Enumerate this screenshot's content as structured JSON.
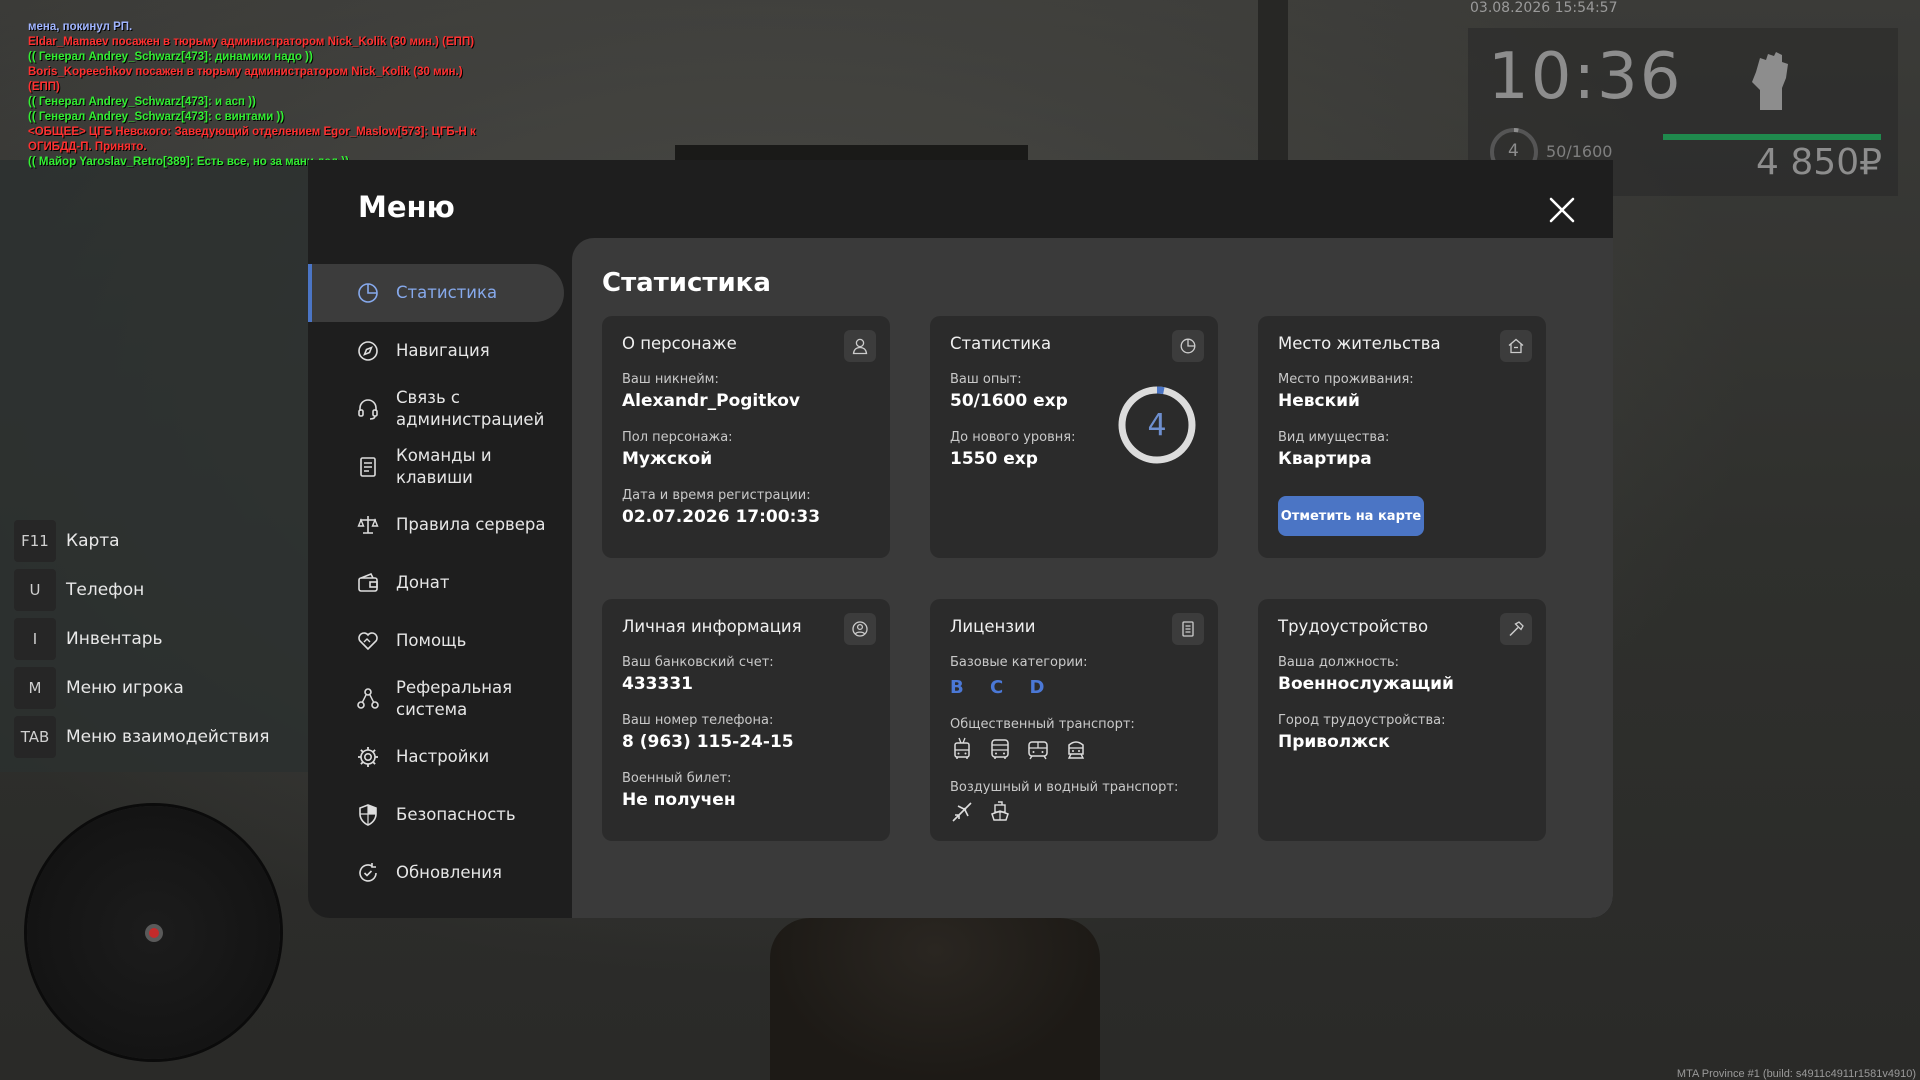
{
  "chat": [
    {
      "text": "мена, покинул РП.",
      "color": "blue"
    },
    {
      "text": "Eldar_Mamaev посажен в тюрьму администратором Nick_Kolik (30 мин.) (ЕПП)",
      "color": "red"
    },
    {
      "text": "(( Генерал Andrey_Schwarz[473]: динамики надо ))",
      "color": "green"
    },
    {
      "text": "Boris_Kopeechkov посажен в тюрьму администратором Nick_Kolik (30 мин.)",
      "color": "red"
    },
    {
      "text": "(ЕПП)",
      "color": "red"
    },
    {
      "text": "(( Генерал Andrey_Schwarz[473]: и асп ))",
      "color": "green"
    },
    {
      "text": "(( Генерал Andrey_Schwarz[473]: с винтами ))",
      "color": "green"
    },
    {
      "text": "<ОБЩЕЕ> ЦГБ Невского: Заведующий отделением Egor_Maslow[573]: ЦГБ-Н к",
      "color": "red"
    },
    {
      "text": " ОГИБДД-П. Принято.",
      "color": "red"
    },
    {
      "text": "(( Майор Yaroslav_Retro[389]: Есть все, но за мани дед ))",
      "color": "green"
    }
  ],
  "hud": {
    "datetime": "03.08.2026 15:54:57",
    "clock": "10:36",
    "level": "4",
    "exp": "50/1600",
    "money": "4 850₽",
    "fist_icon": "fist-icon"
  },
  "keys": [
    {
      "key": "F11",
      "label": "Карта"
    },
    {
      "key": "U",
      "label": "Телефон"
    },
    {
      "key": "I",
      "label": "Инвентарь"
    },
    {
      "key": "M",
      "label": "Меню игрока"
    },
    {
      "key": "TAB",
      "label": "Меню взаимодействия"
    }
  ],
  "build": "MTA Province #1 (build: s4911c4911r1581v4910)",
  "menu": {
    "title": "Меню",
    "nav": [
      {
        "label": "Статистика",
        "icon": "pie-chart-icon"
      },
      {
        "label": "Навигация",
        "icon": "compass-icon"
      },
      {
        "label": "Связь с администрацией",
        "icon": "headset-icon"
      },
      {
        "label": "Команды и клавиши",
        "icon": "document-icon"
      },
      {
        "label": "Правила сервера",
        "icon": "scales-icon"
      },
      {
        "label": "Донат",
        "icon": "wallet-icon"
      },
      {
        "label": "Помощь",
        "icon": "handshake-heart-icon"
      },
      {
        "label": "Реферальная система",
        "icon": "referral-icon"
      },
      {
        "label": "Настройки",
        "icon": "gear-icon"
      },
      {
        "label": "Безопасность",
        "icon": "shield-icon"
      },
      {
        "label": "Обновления",
        "icon": "refresh-check-icon"
      }
    ]
  },
  "stats": {
    "title": "Статистика",
    "character": {
      "title": "О персонаже",
      "nick_label": "Ваш никнейм:",
      "nick": "Alexandr_Pogitkov",
      "gender_label": "Пол персонажа:",
      "gender": "Мужской",
      "reg_label": "Дата и время регистрации:",
      "reg": "02.07.2026 17:00:33"
    },
    "statistics": {
      "title": "Статистика",
      "exp_label": "Ваш опыт:",
      "exp": "50/1600 exp",
      "next_label": "До нового уровня:",
      "next": "1550 exp",
      "level": "4",
      "progress": 0.03125
    },
    "residence": {
      "title": "Место жительства",
      "place_label": "Место проживания:",
      "place": "Невский",
      "property_label": "Вид имущества:",
      "property": "Квартира",
      "button": "Отметить на карте"
    },
    "personal": {
      "title": "Личная информация",
      "bank_label": "Ваш банковский счет:",
      "bank": "433331",
      "phone_label": "Ваш номер телефона:",
      "phone": "8 (963) 115-24-15",
      "military_label": "Военный билет:",
      "military": "Не получен"
    },
    "licenses": {
      "title": "Лицензии",
      "base_label": "Базовые категории:",
      "base": "B C D",
      "public_label": "Общественный транспорт:",
      "public_icons": [
        "trolleybus-icon",
        "bus-icon",
        "tram-icon",
        "train-icon"
      ],
      "air_label": "Воздушный и водный транспорт:",
      "air_icons": [
        "airplane-icon",
        "ship-icon"
      ]
    },
    "job": {
      "title": "Трудоустройство",
      "position_label": "Ваша должность:",
      "position": "Военнослужащий",
      "city_label": "Город трудоустройства:",
      "city": "Приволжск"
    }
  },
  "colors": {
    "accent": "#4b75c5",
    "hp": "#1f8a4d",
    "panel": "#2b2b2b",
    "content": "#3a3a3a"
  }
}
